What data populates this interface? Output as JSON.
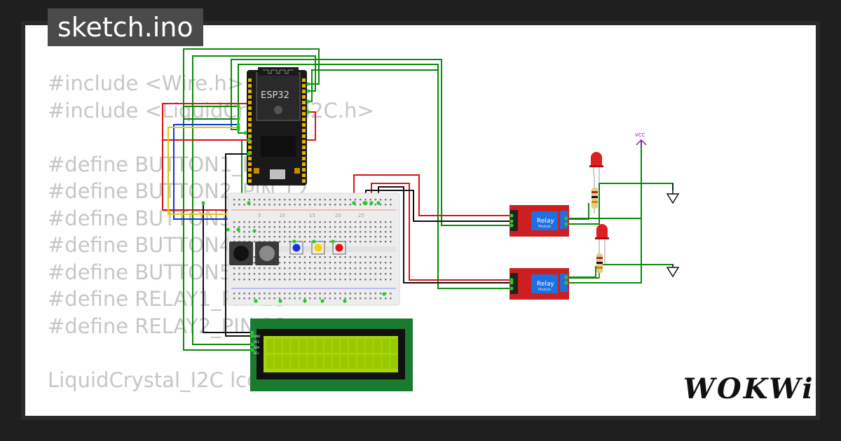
{
  "file_tab": {
    "label": "sketch.ino"
  },
  "code_lines": [
    "#include <Wire.h>",
    "#include <LiquidCrystal_I2C.h>",
    "",
    "#define BUTTON1_PIN 13",
    "#define BUTTON2_PIN 12",
    "#define BUTTON3_PIN 14",
    "#define BUTTON4_PIN 27",
    "#define BUTTON5_PIN 26",
    "#define RELAY1_PIN 25",
    "#define RELAY2_PIN 33",
    "",
    "LiquidCrystal_I2C lcd(0x27, 16, 2);"
  ],
  "board": {
    "label": "ESP32"
  },
  "relay1": {
    "title": "Relay",
    "subtitle": "Module"
  },
  "relay2": {
    "title": "Relay",
    "subtitle": "Module"
  },
  "vcc": {
    "label": "VCC"
  },
  "breadboard": {
    "numbers": [
      "5",
      "10",
      "15",
      "20",
      "25"
    ]
  },
  "lcd": {
    "pins": [
      "GND",
      "VCC",
      "SDA",
      "SCL"
    ]
  },
  "brand": {
    "name": "WOKWi"
  },
  "colors": {
    "background": "#1f1f1f",
    "wire_green": "#0a8a0a",
    "wire_red": "#dd1111",
    "wire_black": "#111111",
    "wire_blue": "#1133dd",
    "wire_yellow": "#e6c800",
    "relay": "#cc1f1f",
    "lcd_screen": "#a6d608",
    "lcd_pcb": "#1a7a2e",
    "led": "#e02020"
  }
}
